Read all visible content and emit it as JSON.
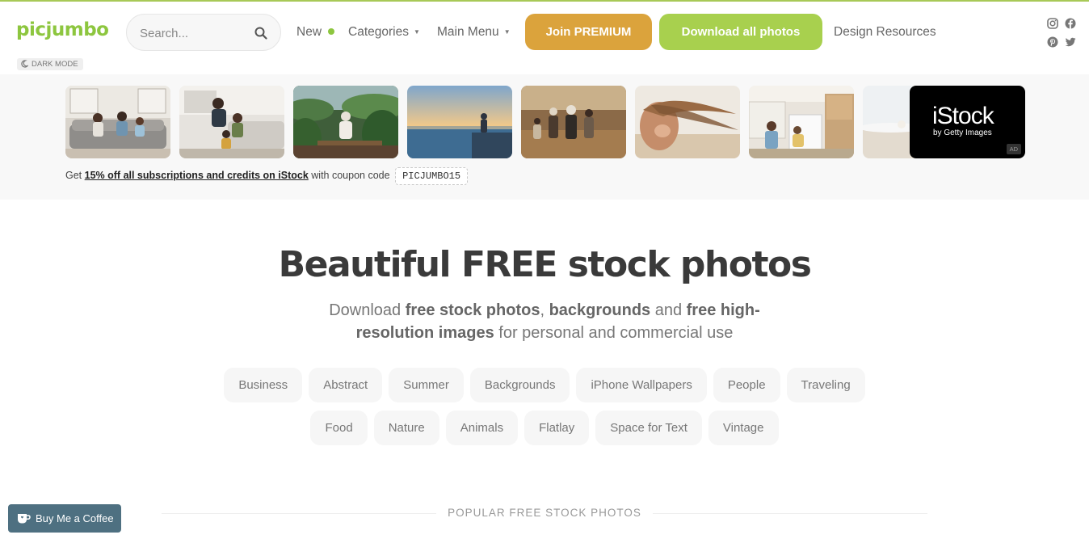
{
  "header": {
    "logo": "picjumbo",
    "search_placeholder": "Search...",
    "nav": {
      "new": "New",
      "categories": "Categories",
      "main_menu": "Main Menu",
      "design_resources": "Design Resources"
    },
    "buttons": {
      "premium": "Join PREMIUM",
      "download_all": "Download all photos"
    },
    "dark_mode": "DARK MODE",
    "social_icons": [
      "instagram-icon",
      "facebook-icon",
      "pinterest-icon",
      "twitter-icon"
    ]
  },
  "ad": {
    "thumbnails": [
      "family on sofa",
      "family playing on couch",
      "senior on terrace",
      "woman at sea",
      "family walking in field",
      "woman hair in wind",
      "family in kitchen",
      "beach scene"
    ],
    "istock_brand": "iStock",
    "istock_sub": "by Getty Images",
    "ad_label": "AD",
    "coupon_prefix": "Get",
    "coupon_link": "15% off all subscriptions and credits on iStock",
    "coupon_middle": "with coupon code",
    "coupon_code": "PICJUMBO15"
  },
  "hero": {
    "title": "Beautiful FREE stock photos",
    "sub_1": "Download ",
    "sub_2": "free stock photos",
    "sub_3": ", ",
    "sub_4": "backgrounds",
    "sub_5": " and ",
    "sub_6": "free high-resolution images",
    "sub_7": " for personal and commercial use"
  },
  "tags_row1": [
    "Business",
    "Abstract",
    "Summer",
    "Backgrounds",
    "iPhone Wallpapers",
    "People",
    "Traveling"
  ],
  "tags_row2": [
    "Food",
    "Nature",
    "Animals",
    "Flatlay",
    "Space for Text",
    "Vintage"
  ],
  "popular_heading": "POPULAR FREE STOCK PHOTOS",
  "buy_me_coffee": "Buy Me a Coffee",
  "colors": {
    "brand_green": "#8dc63f",
    "premium_orange": "#dba33c",
    "download_green": "#a8d04e",
    "coffee_blue": "#4e7081"
  }
}
